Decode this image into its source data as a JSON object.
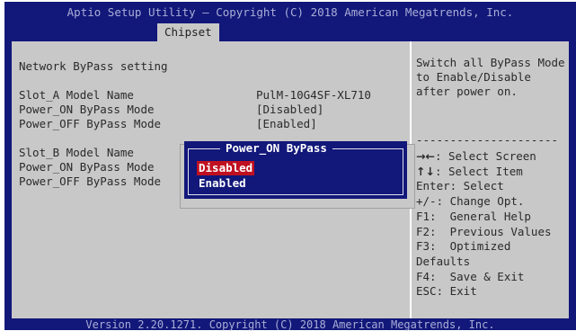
{
  "header": {
    "title": "Aptio Setup Utility – Copyright (C) 2018 American Megatrends, Inc.",
    "tab": "Chipset"
  },
  "settings": {
    "section_title": "Network ByPass setting",
    "slot_a": {
      "model_label": "Slot_A Model Name",
      "model_value": "PulM-10G4SF-XL710",
      "power_on_label": "Power_ON ByPass Mode",
      "power_on_value": "[Disabled]",
      "power_off_label": "Power_OFF ByPass Mode",
      "power_off_value": "[Enabled]"
    },
    "slot_b": {
      "model_label": "Slot_B Model Name",
      "power_on_label": "Power_ON ByPass Mode",
      "power_off_label": "Power_OFF ByPass Mode"
    }
  },
  "help": {
    "lines": [
      "Switch all ByPass Mode",
      "to Enable/Disable",
      "after power on."
    ],
    "separator": "---------------------",
    "keys": [
      {
        "key": "→←",
        "desc": ": Select Screen"
      },
      {
        "key": "↑↓",
        "desc": ": Select Item"
      },
      {
        "key": "",
        "desc": "Enter: Select"
      },
      {
        "key": "",
        "desc": "+/-: Change Opt."
      },
      {
        "key": "",
        "desc": "F1:  General Help"
      },
      {
        "key": "",
        "desc": "F2:  Previous Values"
      },
      {
        "key": "",
        "desc": "F3:  Optimized"
      },
      {
        "key": "",
        "desc": "Defaults"
      },
      {
        "key": "",
        "desc": "F4:  Save & Exit"
      },
      {
        "key": "",
        "desc": "ESC: Exit"
      }
    ]
  },
  "popup": {
    "title": "Power_ON ByPass",
    "options": [
      "Disabled",
      "Enabled"
    ],
    "selected": "Disabled"
  },
  "footer": {
    "text": "Version 2.20.1271. Copyright (C) 2018 American Megatrends, Inc."
  },
  "colors": {
    "background": "#12177a",
    "panel": "#c8c8c8",
    "highlight": "#c01020"
  }
}
